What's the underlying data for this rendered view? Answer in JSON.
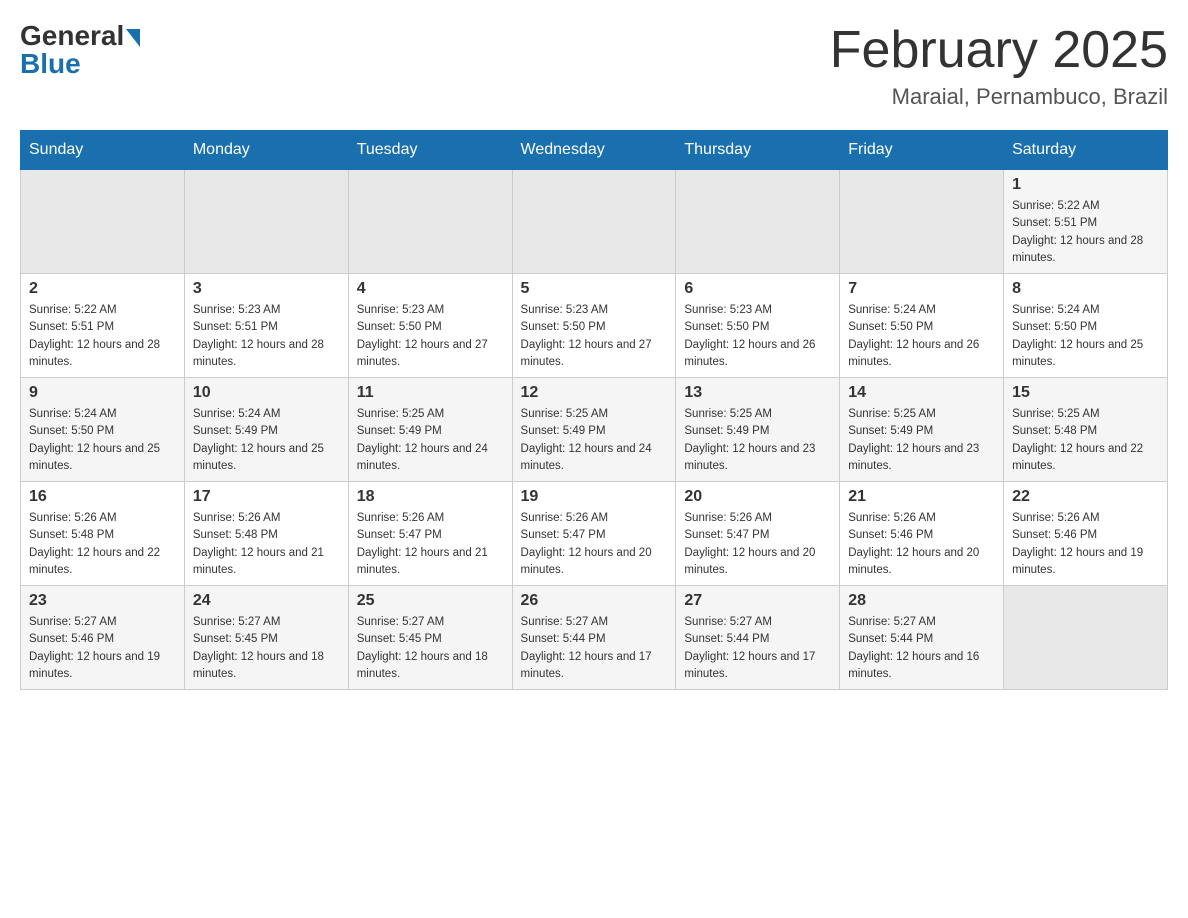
{
  "header": {
    "logo_general": "General",
    "logo_blue": "Blue",
    "month_title": "February 2025",
    "location": "Maraial, Pernambuco, Brazil"
  },
  "weekdays": [
    "Sunday",
    "Monday",
    "Tuesday",
    "Wednesday",
    "Thursday",
    "Friday",
    "Saturday"
  ],
  "weeks": [
    [
      {
        "day": "",
        "sunrise": "",
        "sunset": "",
        "daylight": ""
      },
      {
        "day": "",
        "sunrise": "",
        "sunset": "",
        "daylight": ""
      },
      {
        "day": "",
        "sunrise": "",
        "sunset": "",
        "daylight": ""
      },
      {
        "day": "",
        "sunrise": "",
        "sunset": "",
        "daylight": ""
      },
      {
        "day": "",
        "sunrise": "",
        "sunset": "",
        "daylight": ""
      },
      {
        "day": "",
        "sunrise": "",
        "sunset": "",
        "daylight": ""
      },
      {
        "day": "1",
        "sunrise": "Sunrise: 5:22 AM",
        "sunset": "Sunset: 5:51 PM",
        "daylight": "Daylight: 12 hours and 28 minutes."
      }
    ],
    [
      {
        "day": "2",
        "sunrise": "Sunrise: 5:22 AM",
        "sunset": "Sunset: 5:51 PM",
        "daylight": "Daylight: 12 hours and 28 minutes."
      },
      {
        "day": "3",
        "sunrise": "Sunrise: 5:23 AM",
        "sunset": "Sunset: 5:51 PM",
        "daylight": "Daylight: 12 hours and 28 minutes."
      },
      {
        "day": "4",
        "sunrise": "Sunrise: 5:23 AM",
        "sunset": "Sunset: 5:50 PM",
        "daylight": "Daylight: 12 hours and 27 minutes."
      },
      {
        "day": "5",
        "sunrise": "Sunrise: 5:23 AM",
        "sunset": "Sunset: 5:50 PM",
        "daylight": "Daylight: 12 hours and 27 minutes."
      },
      {
        "day": "6",
        "sunrise": "Sunrise: 5:23 AM",
        "sunset": "Sunset: 5:50 PM",
        "daylight": "Daylight: 12 hours and 26 minutes."
      },
      {
        "day": "7",
        "sunrise": "Sunrise: 5:24 AM",
        "sunset": "Sunset: 5:50 PM",
        "daylight": "Daylight: 12 hours and 26 minutes."
      },
      {
        "day": "8",
        "sunrise": "Sunrise: 5:24 AM",
        "sunset": "Sunset: 5:50 PM",
        "daylight": "Daylight: 12 hours and 25 minutes."
      }
    ],
    [
      {
        "day": "9",
        "sunrise": "Sunrise: 5:24 AM",
        "sunset": "Sunset: 5:50 PM",
        "daylight": "Daylight: 12 hours and 25 minutes."
      },
      {
        "day": "10",
        "sunrise": "Sunrise: 5:24 AM",
        "sunset": "Sunset: 5:49 PM",
        "daylight": "Daylight: 12 hours and 25 minutes."
      },
      {
        "day": "11",
        "sunrise": "Sunrise: 5:25 AM",
        "sunset": "Sunset: 5:49 PM",
        "daylight": "Daylight: 12 hours and 24 minutes."
      },
      {
        "day": "12",
        "sunrise": "Sunrise: 5:25 AM",
        "sunset": "Sunset: 5:49 PM",
        "daylight": "Daylight: 12 hours and 24 minutes."
      },
      {
        "day": "13",
        "sunrise": "Sunrise: 5:25 AM",
        "sunset": "Sunset: 5:49 PM",
        "daylight": "Daylight: 12 hours and 23 minutes."
      },
      {
        "day": "14",
        "sunrise": "Sunrise: 5:25 AM",
        "sunset": "Sunset: 5:49 PM",
        "daylight": "Daylight: 12 hours and 23 minutes."
      },
      {
        "day": "15",
        "sunrise": "Sunrise: 5:25 AM",
        "sunset": "Sunset: 5:48 PM",
        "daylight": "Daylight: 12 hours and 22 minutes."
      }
    ],
    [
      {
        "day": "16",
        "sunrise": "Sunrise: 5:26 AM",
        "sunset": "Sunset: 5:48 PM",
        "daylight": "Daylight: 12 hours and 22 minutes."
      },
      {
        "day": "17",
        "sunrise": "Sunrise: 5:26 AM",
        "sunset": "Sunset: 5:48 PM",
        "daylight": "Daylight: 12 hours and 21 minutes."
      },
      {
        "day": "18",
        "sunrise": "Sunrise: 5:26 AM",
        "sunset": "Sunset: 5:47 PM",
        "daylight": "Daylight: 12 hours and 21 minutes."
      },
      {
        "day": "19",
        "sunrise": "Sunrise: 5:26 AM",
        "sunset": "Sunset: 5:47 PM",
        "daylight": "Daylight: 12 hours and 20 minutes."
      },
      {
        "day": "20",
        "sunrise": "Sunrise: 5:26 AM",
        "sunset": "Sunset: 5:47 PM",
        "daylight": "Daylight: 12 hours and 20 minutes."
      },
      {
        "day": "21",
        "sunrise": "Sunrise: 5:26 AM",
        "sunset": "Sunset: 5:46 PM",
        "daylight": "Daylight: 12 hours and 20 minutes."
      },
      {
        "day": "22",
        "sunrise": "Sunrise: 5:26 AM",
        "sunset": "Sunset: 5:46 PM",
        "daylight": "Daylight: 12 hours and 19 minutes."
      }
    ],
    [
      {
        "day": "23",
        "sunrise": "Sunrise: 5:27 AM",
        "sunset": "Sunset: 5:46 PM",
        "daylight": "Daylight: 12 hours and 19 minutes."
      },
      {
        "day": "24",
        "sunrise": "Sunrise: 5:27 AM",
        "sunset": "Sunset: 5:45 PM",
        "daylight": "Daylight: 12 hours and 18 minutes."
      },
      {
        "day": "25",
        "sunrise": "Sunrise: 5:27 AM",
        "sunset": "Sunset: 5:45 PM",
        "daylight": "Daylight: 12 hours and 18 minutes."
      },
      {
        "day": "26",
        "sunrise": "Sunrise: 5:27 AM",
        "sunset": "Sunset: 5:44 PM",
        "daylight": "Daylight: 12 hours and 17 minutes."
      },
      {
        "day": "27",
        "sunrise": "Sunrise: 5:27 AM",
        "sunset": "Sunset: 5:44 PM",
        "daylight": "Daylight: 12 hours and 17 minutes."
      },
      {
        "day": "28",
        "sunrise": "Sunrise: 5:27 AM",
        "sunset": "Sunset: 5:44 PM",
        "daylight": "Daylight: 12 hours and 16 minutes."
      },
      {
        "day": "",
        "sunrise": "",
        "sunset": "",
        "daylight": ""
      }
    ]
  ]
}
